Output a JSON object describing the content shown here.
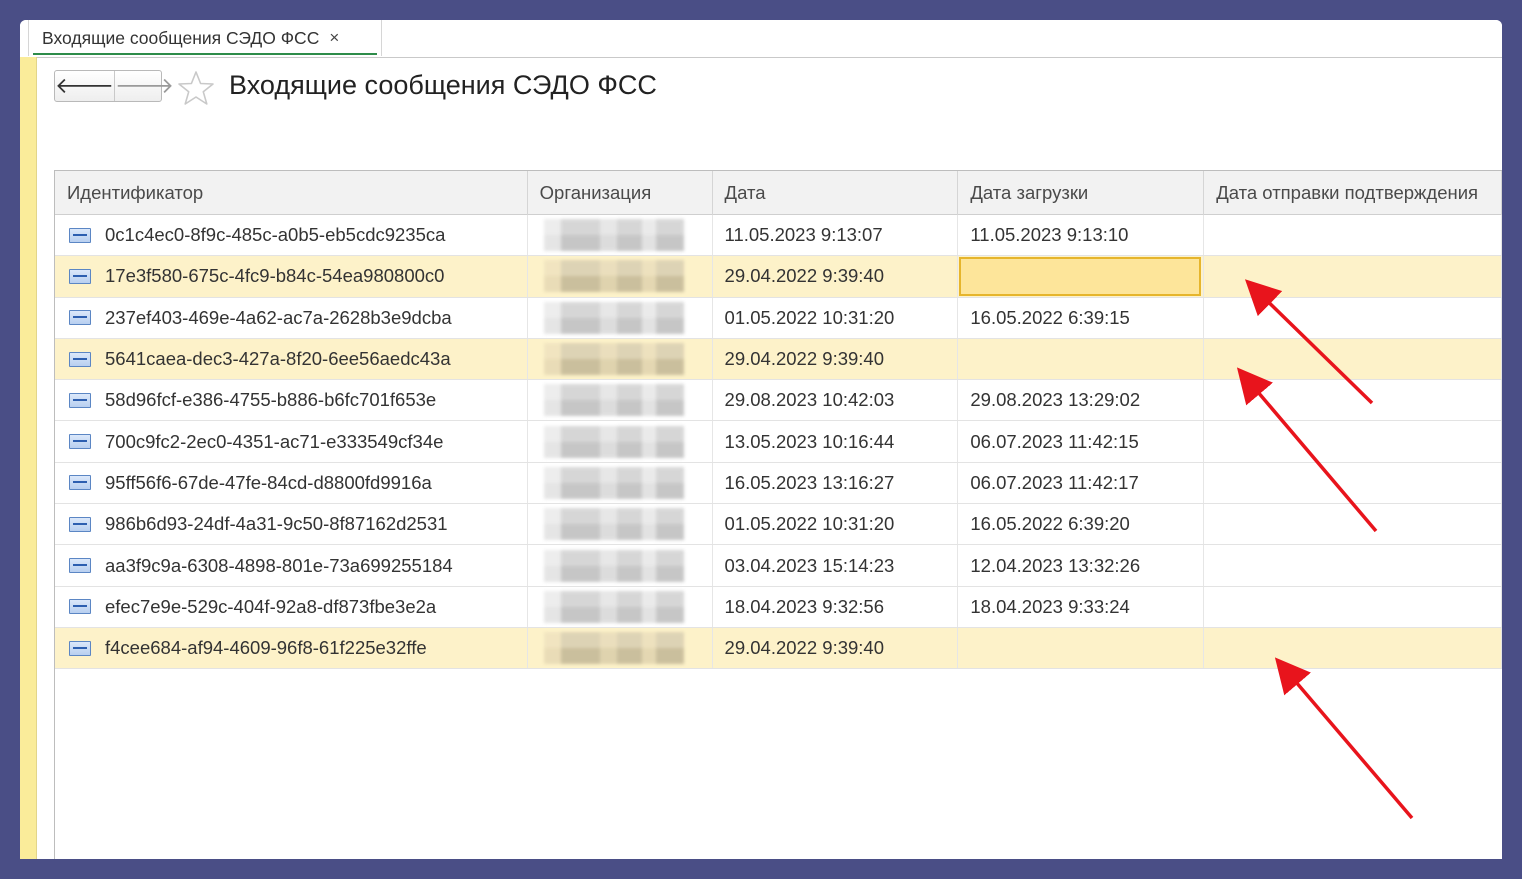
{
  "tab": {
    "label": "Входящие сообщения СЭДО ФСС",
    "close_glyph": "×"
  },
  "nav": {
    "back_glyph": "🡐",
    "forward_glyph": "🡒"
  },
  "page": {
    "title": "Входящие сообщения СЭДО ФСС"
  },
  "table": {
    "columns": [
      "Идентификатор",
      "Организация",
      "Дата",
      "Дата загрузки",
      "Дата отправки подтверждения"
    ],
    "rows": [
      {
        "id": "0c1c4ec0-8f9c-485c-a0b5-eb5cdc9235ca",
        "date": "11.05.2023 9:13:07",
        "loaded": "11.05.2023 9:13:10",
        "confirm": ""
      },
      {
        "id": "17e3f580-675c-4fc9-b84c-54ea980800c0",
        "date": "29.04.2022 9:39:40",
        "loaded": "",
        "confirm": ""
      },
      {
        "id": "237ef403-469e-4a62-ac7a-2628b3e9dcba",
        "date": "01.05.2022 10:31:20",
        "loaded": "16.05.2022 6:39:15",
        "confirm": ""
      },
      {
        "id": "5641caea-dec3-427a-8f20-6ee56aedc43a",
        "date": "29.04.2022 9:39:40",
        "loaded": "",
        "confirm": ""
      },
      {
        "id": "58d96fcf-e386-4755-b886-b6fc701f653e",
        "date": "29.08.2023 10:42:03",
        "loaded": "29.08.2023 13:29:02",
        "confirm": ""
      },
      {
        "id": "700c9fc2-2ec0-4351-ac71-e333549cf34e",
        "date": "13.05.2023 10:16:44",
        "loaded": "06.07.2023 11:42:15",
        "confirm": ""
      },
      {
        "id": "95ff56f6-67de-47fe-84cd-d8800fd9916a",
        "date": "16.05.2023 13:16:27",
        "loaded": "06.07.2023 11:42:17",
        "confirm": ""
      },
      {
        "id": "986b6d93-24df-4a31-9c50-8f87162d2531",
        "date": "01.05.2022 10:31:20",
        "loaded": "16.05.2022 6:39:20",
        "confirm": ""
      },
      {
        "id": "aa3f9c9a-6308-4898-801e-73a699255184",
        "date": "03.04.2023 15:14:23",
        "loaded": "12.04.2023 13:32:26",
        "confirm": ""
      },
      {
        "id": "efec7e9e-529c-404f-92a8-df873fbe3e2a",
        "date": "18.04.2023 9:32:56",
        "loaded": "18.04.2023 9:33:24",
        "confirm": ""
      },
      {
        "id": "f4cee684-af94-4609-96f8-61f225e32ffe",
        "date": "29.04.2022 9:39:40",
        "loaded": "",
        "confirm": ""
      }
    ],
    "highlighted_rows": [
      1,
      3,
      10
    ],
    "selected_cell": {
      "row": 1,
      "column": "Дата загрузки"
    }
  },
  "colors": {
    "background": "#4a4e86",
    "row_highlight": "#fdf2c9",
    "selected_cell": "#fde59a",
    "annotation_arrow": "#e8141c",
    "tab_underline": "#2e8c4a"
  }
}
